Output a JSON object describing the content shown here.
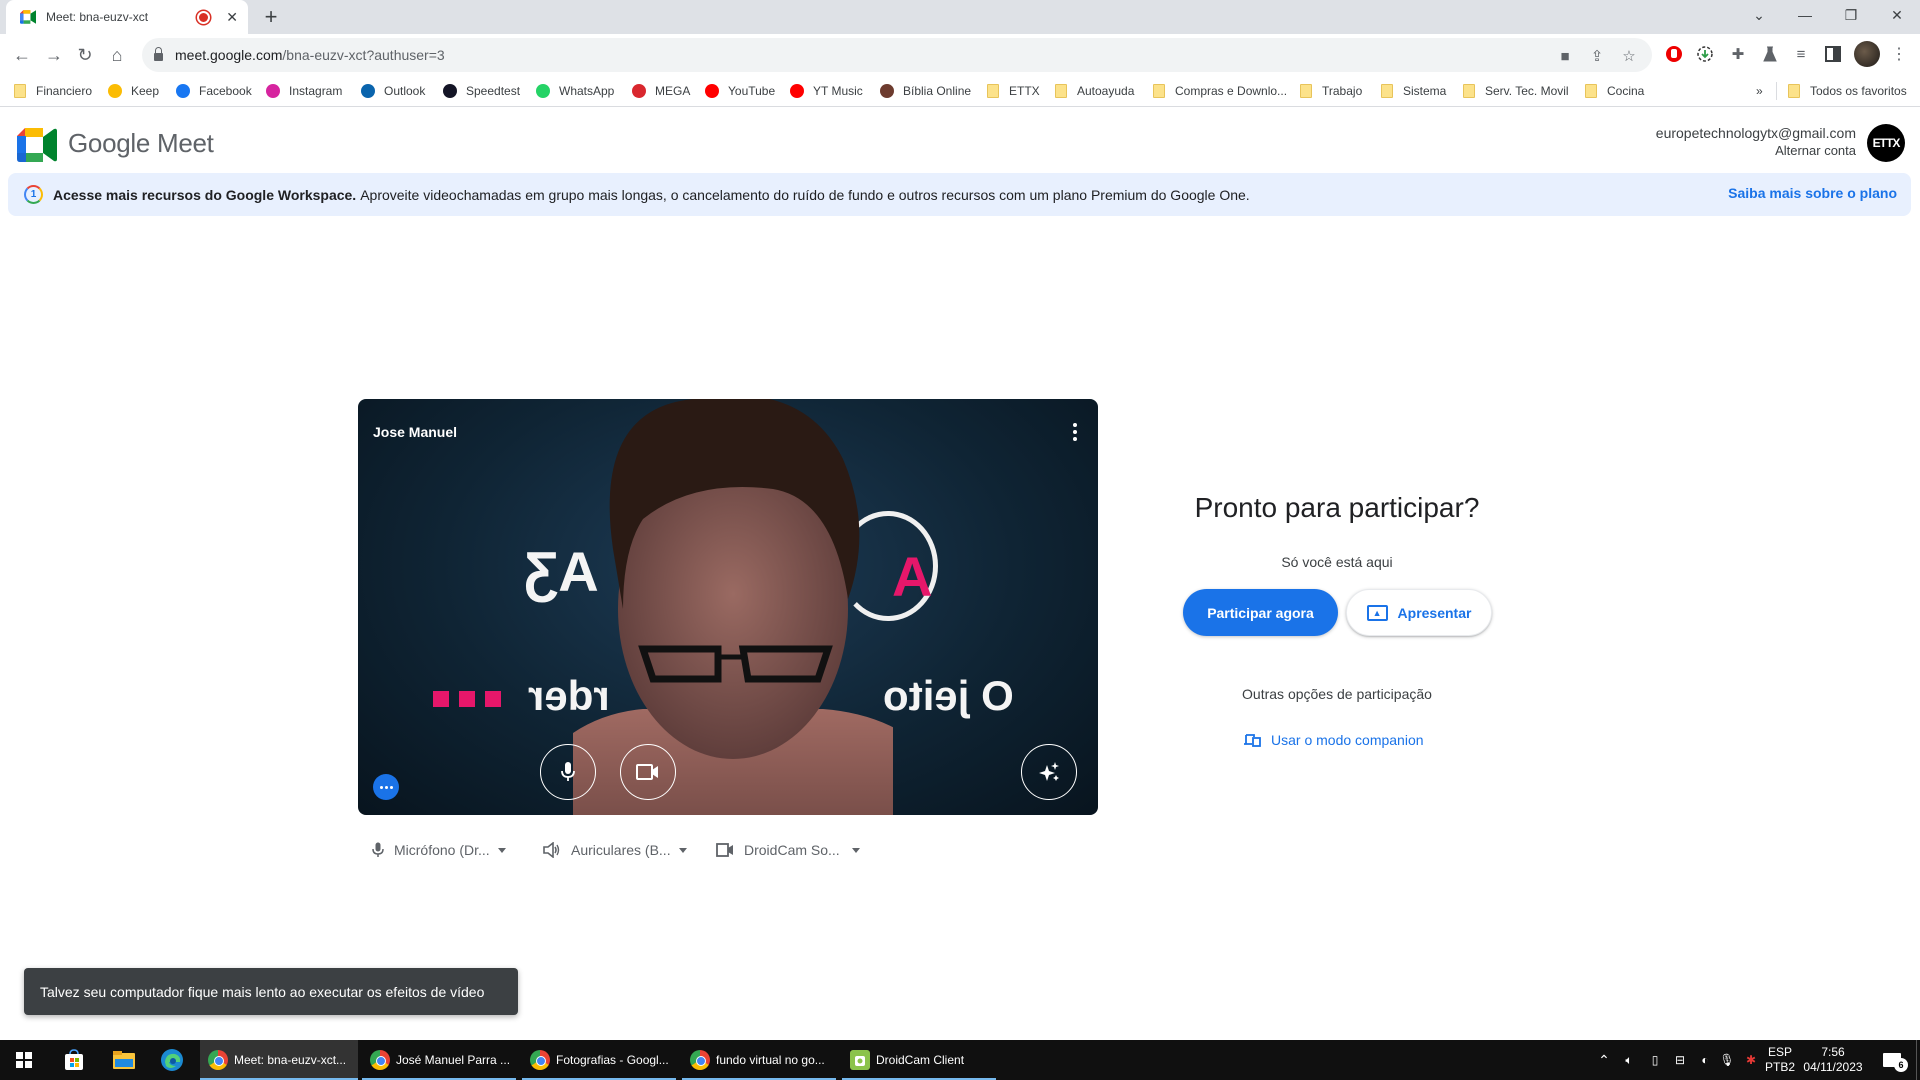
{
  "browser": {
    "tab_title": "Meet: bna-euzv-xct",
    "new_tab_label": "+",
    "url_host": "meet.google.com",
    "url_path": "/bna-euzv-xct?authuser=3",
    "window_controls": {
      "tab_search": "⌄",
      "minimize": "—",
      "restore": "❐",
      "close": "✕"
    },
    "bookmarks": [
      {
        "label": "Financiero",
        "icon": "folder-icon"
      },
      {
        "label": "Keep",
        "icon": "keep-icon",
        "color": "#fbbc04"
      },
      {
        "label": "Facebook",
        "icon": "facebook-icon",
        "color": "#1877f2"
      },
      {
        "label": "Instagram",
        "icon": "instagram-icon",
        "color": "#d6249f"
      },
      {
        "label": "Outlook",
        "icon": "outlook-icon",
        "color": "#0a64ad"
      },
      {
        "label": "Speedtest",
        "icon": "speedtest-icon",
        "color": "#141526"
      },
      {
        "label": "WhatsApp",
        "icon": "whatsapp-icon",
        "color": "#25d366"
      },
      {
        "label": "MEGA",
        "icon": "mega-icon",
        "color": "#d9272e"
      },
      {
        "label": "YouTube",
        "icon": "youtube-icon",
        "color": "#ff0000"
      },
      {
        "label": "YT Music",
        "icon": "ytmusic-icon",
        "color": "#ff0000"
      },
      {
        "label": "Bíblia Online",
        "icon": "bible-icon",
        "color": "#6d3b2e"
      },
      {
        "label": "ETTX",
        "icon": "folder-icon"
      },
      {
        "label": "Autoayuda",
        "icon": "folder-icon"
      },
      {
        "label": "Compras e Downlo...",
        "icon": "folder-icon"
      },
      {
        "label": "Trabajo",
        "icon": "folder-icon"
      },
      {
        "label": "Sistema",
        "icon": "folder-icon"
      },
      {
        "label": "Serv. Tec. Movil",
        "icon": "folder-icon"
      },
      {
        "label": "Cocina",
        "icon": "folder-icon"
      }
    ],
    "bookmarks_overflow": "»",
    "all_bookmarks": "Todos os favoritos"
  },
  "meet": {
    "brand": "Google Meet",
    "account_email": "europetechnologytx@gmail.com",
    "switch_account": "Alternar conta",
    "avatar_text": "ETTX",
    "banner": {
      "bold": "Acesse mais recursos do Google Workspace.",
      "text": "Aproveite videochamadas em grupo mais longas, o cancelamento do ruído de fundo e outros recursos com um plano Premium do Google One.",
      "link": "Saiba mais sobre o plano",
      "icon_text": "1"
    },
    "preview": {
      "self_name": "Jose Manuel",
      "bg_text_top": "AƷ",
      "bg_text_bottom": "O jeito o   rder"
    },
    "devices": [
      {
        "label": "Micrófono (Dr...",
        "icon": "microphone-icon"
      },
      {
        "label": "Auriculares (B...",
        "icon": "speaker-icon"
      },
      {
        "label": "DroidCam So...",
        "icon": "camera-icon"
      }
    ],
    "ready_title": "Pronto para participar?",
    "only_you": "Só você está aqui",
    "join_label": "Participar agora",
    "present_label": "Apresentar",
    "other_options": "Outras opções de participação",
    "companion_label": "Usar o modo companion",
    "toast": "Talvez seu computador fique mais lento ao executar os efeitos de vídeo",
    "colors": {
      "accent": "#1a73e8",
      "banner_bg": "#e8f0fe",
      "toast_bg": "#3c4043"
    }
  },
  "taskbar": {
    "apps": [
      {
        "label": "Meet: bna-euzv-xct...",
        "active": true
      },
      {
        "label": "José Manuel Parra ...",
        "active": false
      },
      {
        "label": "Fotografias - Googl...",
        "active": false
      },
      {
        "label": "fundo virtual no go...",
        "active": false
      },
      {
        "label": "DroidCam Client",
        "active": false
      }
    ],
    "lang_top": "ESP",
    "lang_bottom": "PTB2",
    "time": "7:56",
    "date": "04/11/2023",
    "notifications": "6"
  }
}
